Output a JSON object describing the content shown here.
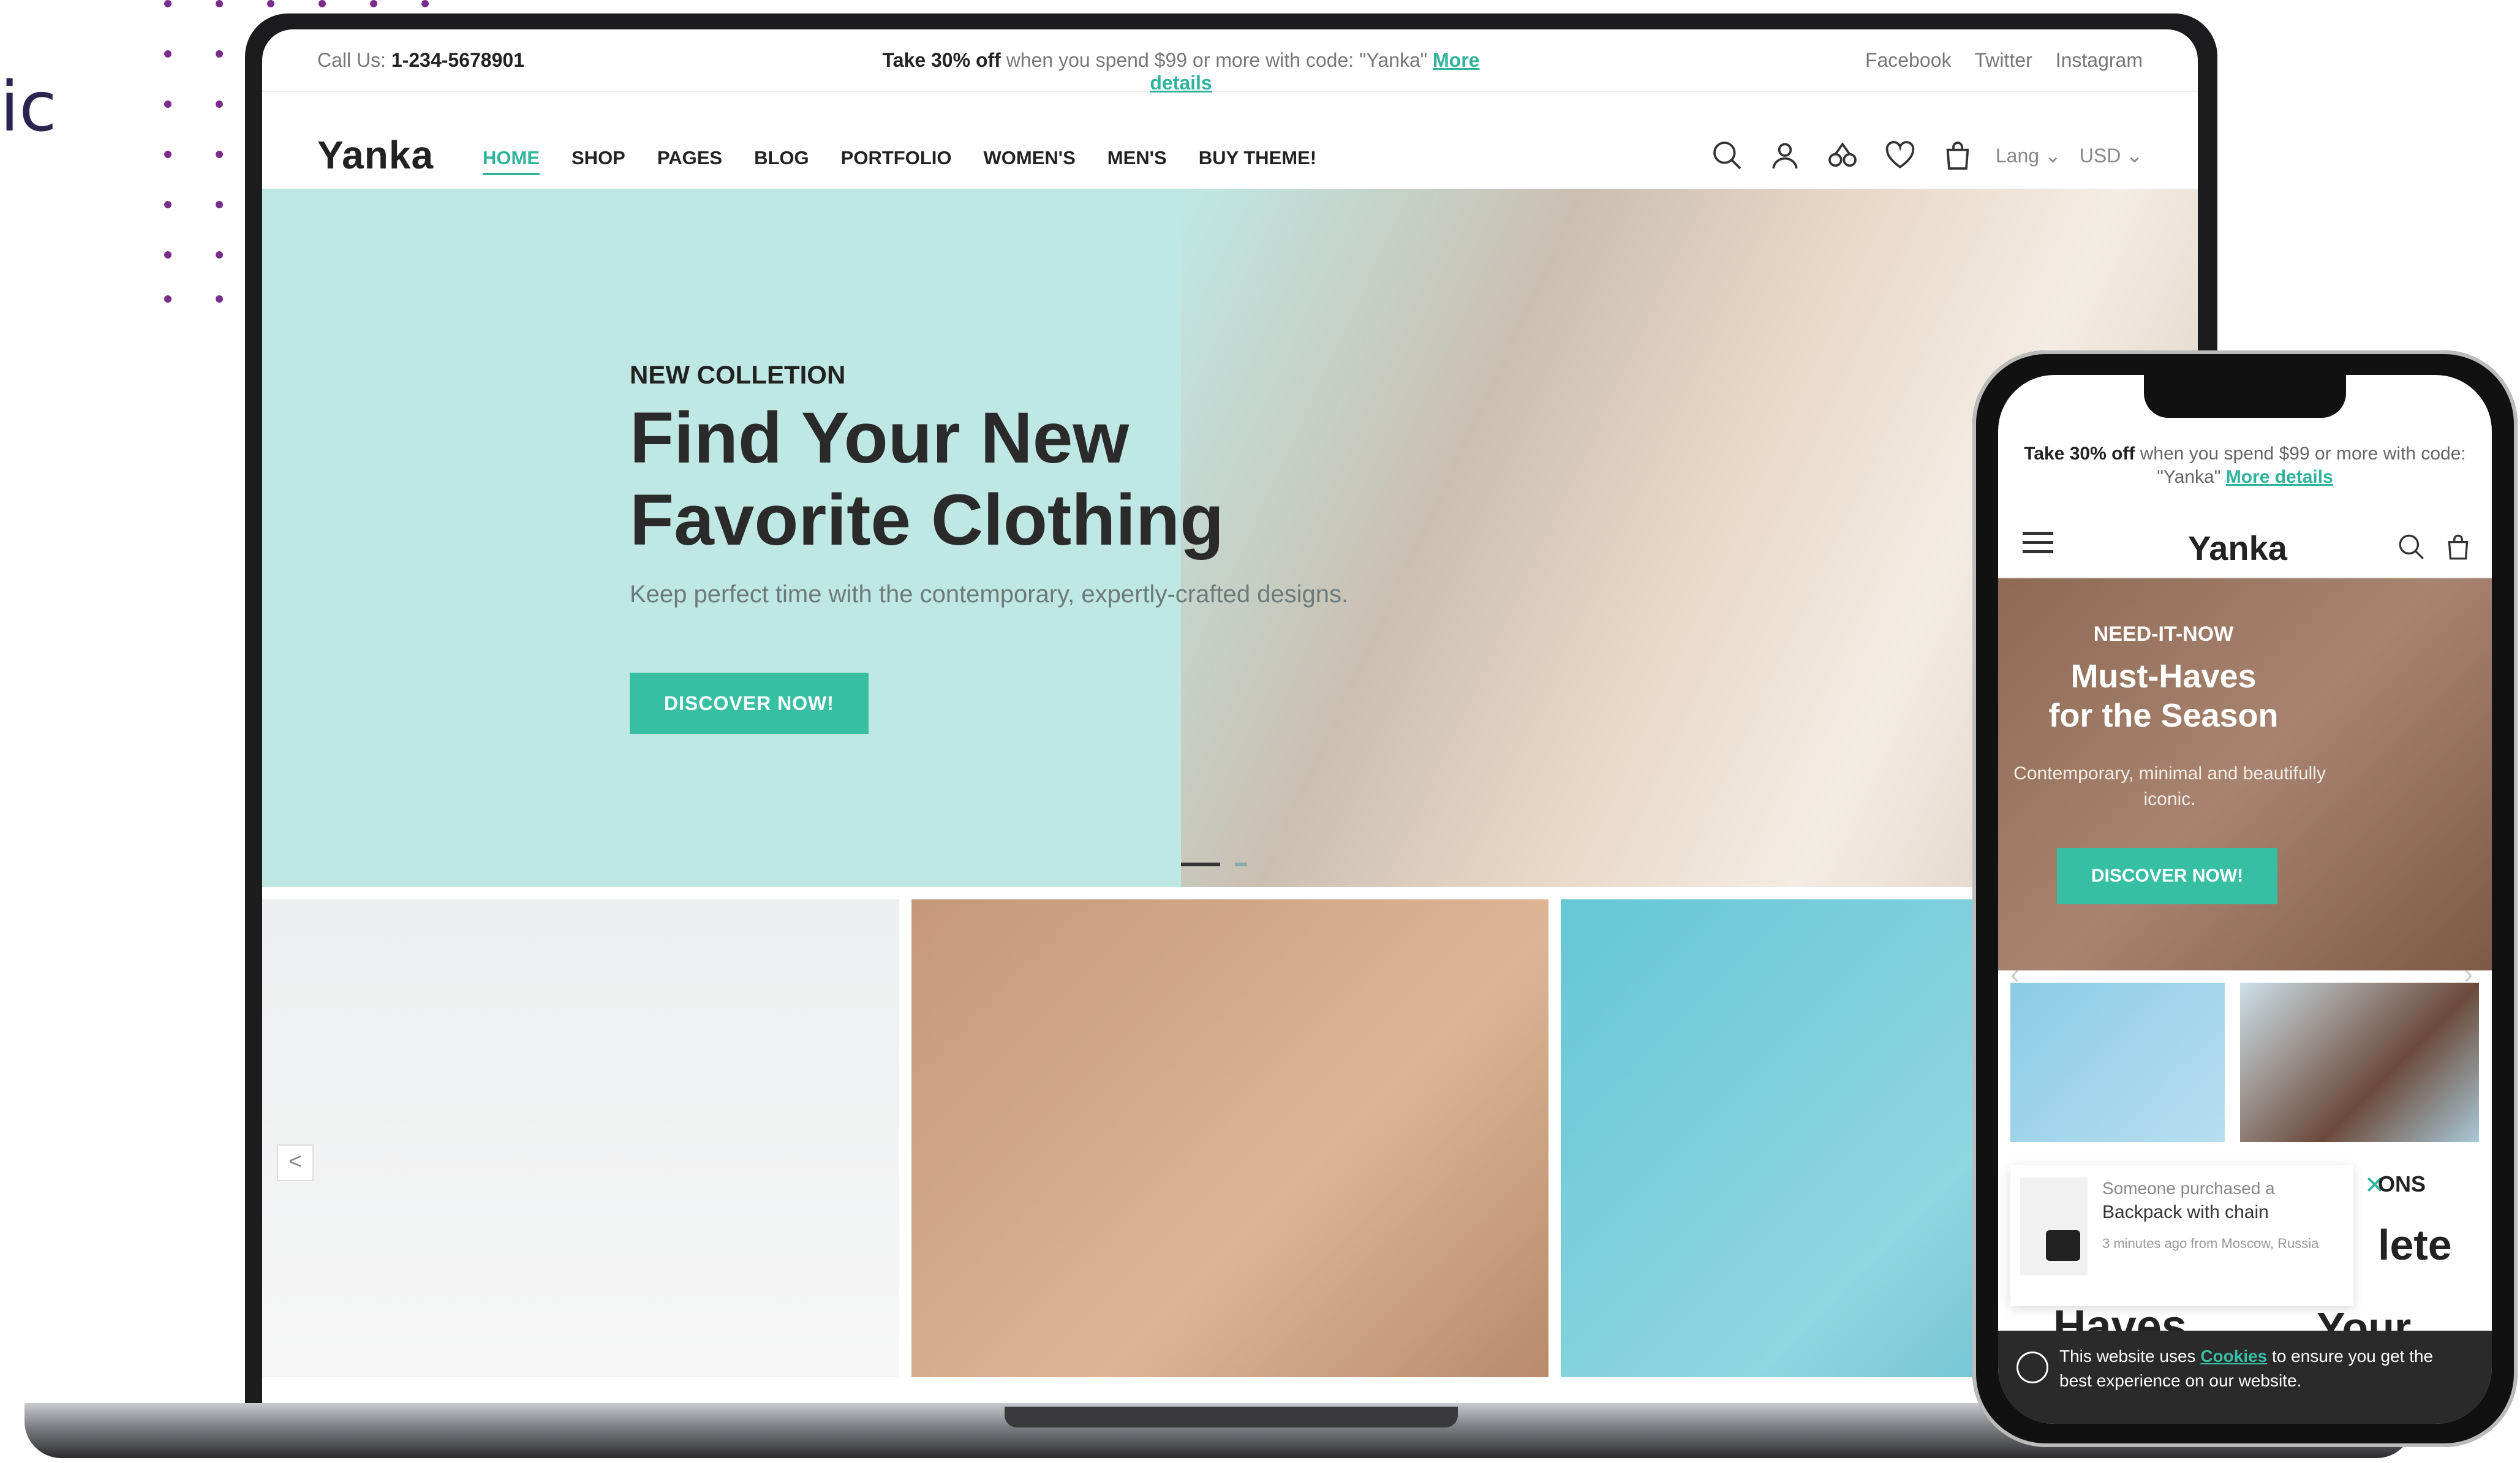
{
  "fragment_text": "ic",
  "laptop": {
    "topbar": {
      "call_label": "Call Us:",
      "phone": "1-234-5678901",
      "promo_bold": "Take 30% off",
      "promo_text": "when you spend $99 or more with code: \"Yanka\"",
      "promo_link": "More details",
      "social": [
        "Facebook",
        "Twitter",
        "Instagram"
      ]
    },
    "logo": "Yanka",
    "nav": [
      "HOME",
      "SHOP",
      "PAGES",
      "BLOG",
      "PORTFOLIO",
      "WOMEN'S",
      "MEN'S",
      "BUY THEME!"
    ],
    "lang": "Lang",
    "currency": "USD",
    "hero": {
      "kicker": "NEW COLLETION",
      "title_line1": "Find Your New",
      "title_line2": "Favorite Clothing",
      "subtitle": "Keep perfect time with the contemporary, expertly-crafted designs.",
      "cta": "DISCOVER NOW!"
    },
    "tile_arrow": "<"
  },
  "phone": {
    "promo_bold": "Take 30% off",
    "promo_text": "when you spend $99 or more with code: \"Yanka\"",
    "promo_link": "More details",
    "logo": "Yanka",
    "hero": {
      "kicker": "NEED-IT-NOW",
      "title_line1": "Must-Haves",
      "title_line2": "for the Season",
      "subtitle": "Contemporary, minimal and beautifully iconic.",
      "cta": "DISCOVER NOW!"
    },
    "notification": {
      "line1": "Someone purchased a",
      "line2": "Backpack with chain",
      "line3": "3 minutes ago from Moscow, Russia"
    },
    "frag_right_small": "ONS",
    "frag_right_big": "lete",
    "frag_bottom_left": "Haves",
    "frag_bottom_right": "Your",
    "cookie": {
      "pre": "This website uses",
      "link": "Cookies",
      "post": "to ensure you get the best experience on our website."
    }
  }
}
